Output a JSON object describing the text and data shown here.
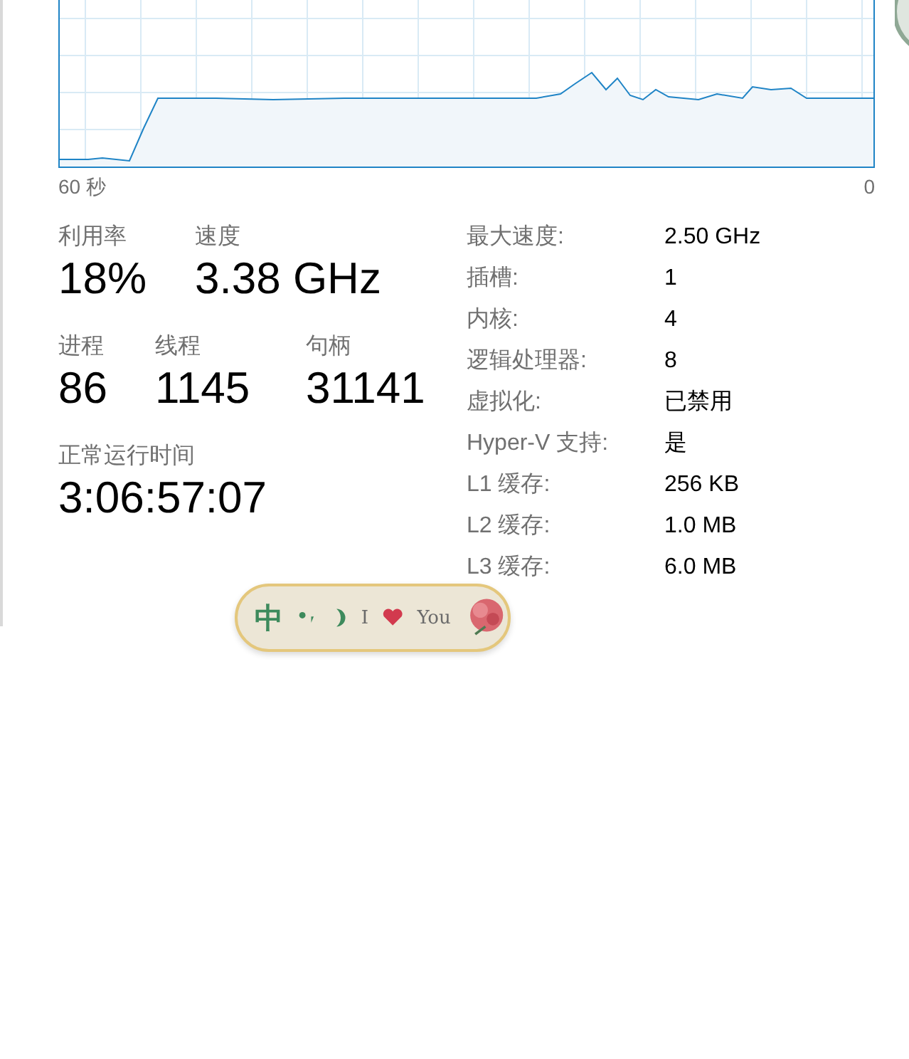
{
  "graph": {
    "time_start": "60 秒",
    "time_end": "0"
  },
  "stats": [
    {
      "label": "利用率",
      "value": "18%"
    },
    {
      "label": "速度",
      "value": "3.38 GHz"
    },
    {
      "label": "进程",
      "value": "86"
    },
    {
      "label": "线程",
      "value": "1145"
    },
    {
      "label": "句柄",
      "value": "31141"
    },
    {
      "label": "正常运行时间",
      "value": "3:06:57:07"
    }
  ],
  "details": [
    {
      "label": "最大速度:",
      "value": "2.50 GHz"
    },
    {
      "label": "插槽:",
      "value": "1"
    },
    {
      "label": "内核:",
      "value": "4"
    },
    {
      "label": "逻辑处理器:",
      "value": "8"
    },
    {
      "label": "虚拟化:",
      "value": "已禁用"
    },
    {
      "label": "Hyper-V 支持:",
      "value": "是"
    },
    {
      "label": "L1 缓存:",
      "value": "256 KB"
    },
    {
      "label": "L2 缓存:",
      "value": "1.0 MB"
    },
    {
      "label": "L3 缓存:",
      "value": "6.0 MB"
    }
  ],
  "ime": {
    "mode": "中",
    "skin_text": [
      "I",
      "You"
    ]
  }
}
